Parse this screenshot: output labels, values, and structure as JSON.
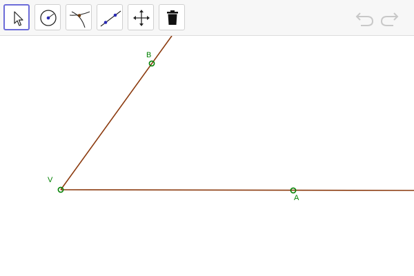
{
  "toolbar": {
    "tools": [
      {
        "icon": "pointer-arrow-icon",
        "selected": true
      },
      {
        "icon": "circle-center-point-icon",
        "selected": false
      },
      {
        "icon": "intersect-curves-icon",
        "selected": false
      },
      {
        "icon": "line-through-two-points-icon",
        "selected": false
      },
      {
        "icon": "move-graphics-view-icon",
        "selected": false
      },
      {
        "icon": "trash-delete-icon",
        "selected": false
      }
    ],
    "undo_icon": "undo-arrow-icon",
    "redo_icon": "redo-arrow-icon",
    "colors": {
      "selected_border": "#6b6bd8",
      "undo_redo_disabled": "#c8c8c8"
    }
  },
  "construction": {
    "points": {
      "B": {
        "label": "B"
      },
      "V": {
        "label": "V"
      },
      "A": {
        "label": "A"
      }
    },
    "colors": {
      "ray": "#8b3a0e",
      "point": "#008000",
      "label": "#008000"
    }
  }
}
